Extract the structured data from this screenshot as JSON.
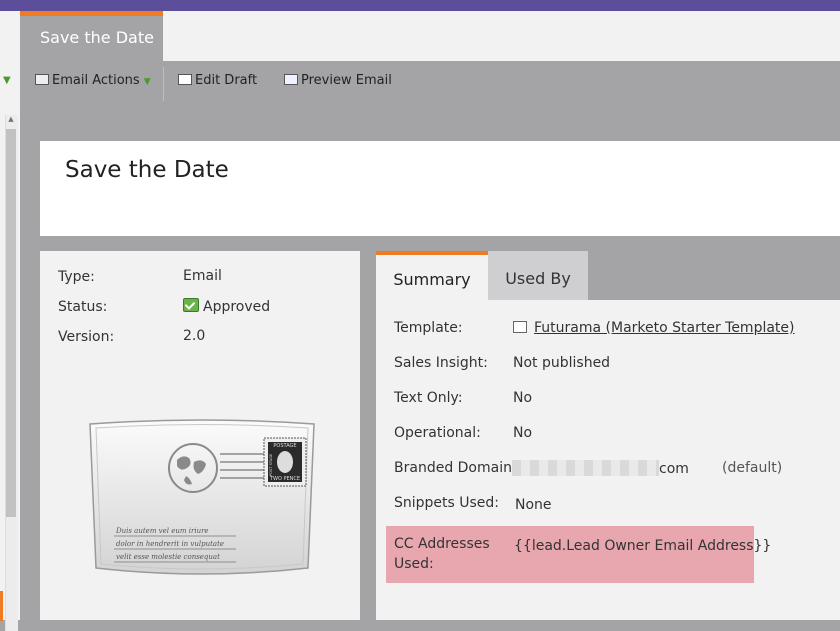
{
  "page_tab": {
    "label": "Save the Date"
  },
  "toolbar": {
    "email_actions": "Email Actions",
    "edit_draft": "Edit Draft",
    "preview_email": "Preview Email"
  },
  "asset": {
    "title": "Save the Date",
    "type_label": "Type:",
    "type_value": "Email",
    "status_label": "Status:",
    "status_value": "Approved",
    "version_label": "Version:",
    "version_value": "2.0"
  },
  "envelope_art": {
    "stamp_top": "POSTAGE",
    "stamp_bottom": "TWO PENCE",
    "stamp_left": "POST STAGE",
    "lines": [
      "Duis autem vel eum iriure",
      "dolor in hendrerit in vulputate",
      "velit esse molestie consequat"
    ]
  },
  "tabs": {
    "summary": "Summary",
    "used_by": "Used By"
  },
  "summary": {
    "template_label": "Template:",
    "template_value": "Futurama (Marketo Starter Template)",
    "sales_insight_label": "Sales Insight:",
    "sales_insight_value": "Not published",
    "text_only_label": "Text Only:",
    "text_only_value": "No",
    "operational_label": "Operational:",
    "operational_value": "No",
    "branded_domain_label": "Branded Domain:",
    "branded_domain_suffix": "com",
    "branded_domain_default": "(default)",
    "snippets_label": "Snippets Used:",
    "snippets_value": "None",
    "cc_label_1": "CC Addresses",
    "cc_label_2": "Used:",
    "cc_value": "{{lead.Lead Owner Email Address}}"
  },
  "colors": {
    "accent": "#f07b22",
    "topbar": "#5c4e9b",
    "highlight": "#e8a6af",
    "panel_bg": "#f2f2f2"
  }
}
